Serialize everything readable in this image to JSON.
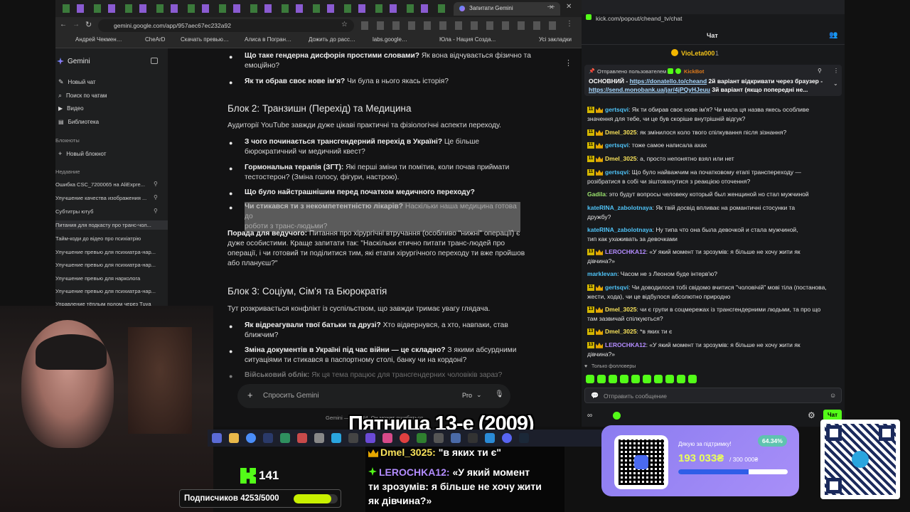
{
  "browser": {
    "address": "gemini.google.com/app/957aec67ec232a92",
    "tab_title": "Запитати Gemini",
    "bookmarks": [
      "Андрей Чекменёк...",
      "CheArD",
      "Скачать превью об...",
      "Алиса в Погранични...",
      "Дожить до рассвет...",
      "labs.google/fx/ru/fx",
      "Юла - Нация Созда...",
      "Усі закладки"
    ]
  },
  "gemini": {
    "brand": "Gemini",
    "nav": [
      "Новый чат",
      "Поиск по чатам",
      "Видео",
      "Библиотека"
    ],
    "notebooks_header": "Блокноты",
    "new_notebook": "Новый блокнот",
    "recent_header": "Недавние",
    "recent": [
      "Ошибка CSC_7200065 на AliExpre...",
      "Улучшение качества изображения ...",
      "Субтитры ютуб",
      "Питания для подкасту про транс-чол...",
      "Тайм-коди до відео про психіатрію",
      "Улучшение превью для психиатра-нар...",
      "Улучшение превью для психиатра-нар...",
      "Улучшение превью для нарколога",
      "Улучшение превью для психиатра-нар...",
      "Управление тёплым полом через Tuya"
    ],
    "content": {
      "b0_bold": "Що таке гендерна дисфорія простими словами?",
      "b0_rest": " Як вона відчувається фізично та",
      "b0_line2": "емоційно?",
      "b1_bold": "Як ти обрав своє нове ім'я?",
      "b1_rest": " Чи була в нього якась історія?",
      "h_block2": "Блок 2: Транзишн (Перехід) та Медицина",
      "p_block2": "Аудиторії YouTube завжди дуже цікаві практичні та фізіологічні аспекти переходу.",
      "b2_bold": "З чого починається трансгендерний перехід в Україні?",
      "b2_rest": " Це більше",
      "b2_line2": "бюрократичний чи медичний квест?",
      "b3_bold": "Гормональна терапія (ЗГТ):",
      "b3_rest": " Які перші зміни ти помітив, коли почав приймати",
      "b3_line2": "тестостерон? (Зміна голосу, фігури, настрою).",
      "b4_bold": "Що було найстрашнішим перед початком медичного переходу?",
      "b5_bold": "Чи стикався ти з некомпетентністю лікарів?",
      "b5_rest": " Наскільки наша медицина готова до",
      "b5_line2": "роботи з транс-людьми?",
      "tip_bold": "Порада для ведучого:",
      "tip_rest": " Питання про хірургічні втручання (особливо \"нижні\" операції) є",
      "tip_l2": "дуже особистими. Краще запитати так: \"Наскільки етично питати транс-людей про",
      "tip_l3": "операції, і чи готовий ти поділитися тим, які етапи хірургічного переходу ти вже пройшов",
      "tip_l4": "або плануєш?\"",
      "h_block3": "Блок 3: Соціум, Сім'я та Бюрократія",
      "p_block3": "Тут розкривається конфлікт із суспільством, що завжди тримає увагу глядача.",
      "b6_bold": "Як відреагували твої батьки та друзі?",
      "b6_rest": " Хто відвернувся, а хто, навпаки, став",
      "b6_line2": "ближчим?",
      "b7_bold": "Зміна документів в Україні під час війни — це складно?",
      "b7_rest": " З якими абсурдними",
      "b7_line2": "ситуаціями ти стикався в паспортному столі, банку чи на кордоні?",
      "b8_bold": "Військовий облік:",
      "b8_rest": " Як ця тема працює для трансгендерних чоловіків зараз?"
    },
    "input_placeholder": "Спросить Gemini",
    "mode": "Pro",
    "footer": "Gemini — это ИИ. Он может ошибаться"
  },
  "chat": {
    "url": "kick.com/popout/cheand_tv/chat",
    "title": "Чат",
    "top_gifter": "VioLeta000",
    "top_gifter_count": "1",
    "pinned_by": "Отправлено пользователем",
    "pinned_user": "KickBot",
    "pinned_text1": "ОСНОВНИЙ - ",
    "pinned_link1": "https://donatello.to/cheand",
    "pinned_text2": " 2й варіант відкривати через браузер -",
    "pinned_link2": "https://send.monobank.ua/jar/4jPQyHJeuu",
    "pinned_text3": " 3й варіант (якщо попередні не...",
    "messages": [
      {
        "b": "11",
        "u": "gertsqvi",
        "c": "#4fc3f7",
        "t": "Як ти обирав своє нове ім'я? Чи мала ця назва якесь особливе",
        "t2": "значення для тебе, чи це був скоріше внутрішній відгук?"
      },
      {
        "b": "11",
        "u": "Dmel_3025",
        "c": "#f7e15a",
        "t": "як змінилося коло твого спілкування після зізнання?"
      },
      {
        "b": "11",
        "u": "gertsqvi",
        "c": "#4fc3f7",
        "t": "тоже самое написала ахах"
      },
      {
        "b": "11",
        "u": "Dmel_3025",
        "c": "#f7e15a",
        "t": "а, просто непонятно взял или нет"
      },
      {
        "b": "11",
        "u": "gertsqvi",
        "c": "#4fc3f7",
        "t": "Що було найважчим на початковому етапі трансперexоду —",
        "t2": "розібратися в собі чи зіштовхнутися з реакцією оточення?"
      },
      {
        "b": "",
        "u": "Gadila",
        "c": "#9be36d",
        "t": "это будут вопросы человеку который был женщиной но стал мужчиной"
      },
      {
        "b": "",
        "u": "kateRINA_zabolotnaya",
        "c": "#4fc3f7",
        "t": "Як твій досвід впливає на романтичні стосунки та",
        "t2": "дружбу?"
      },
      {
        "b": "",
        "u": "kateRINA_zabolotnaya",
        "c": "#4fc3f7",
        "t": "Ну типа что она была девочкой и стала мужчиной,",
        "t2": "тип как ухаживать за девочками"
      },
      {
        "b": "13",
        "u": "LEROCHKA12",
        "c": "#b38cff",
        "t": "«У який момент ти зрозумів: я більше не хочу жити як",
        "t2": "дівчина?»"
      },
      {
        "b": "",
        "u": "marklevan",
        "c": "#4fc3f7",
        "t": "Часом не з Леоном буде інтерв'ю?"
      },
      {
        "b": "11",
        "u": "gertsqvi",
        "c": "#4fc3f7",
        "t": "Чи доводилося тобі свідомо вчитися \"чоловічій\" мові тіла (постанова,",
        "t2": "жести, хода), чи це відбулося абсолютно природно"
      },
      {
        "b": "13",
        "u": "Dmel_3025",
        "c": "#f7e15a",
        "t": "чи є групи в соцмережах із трансгендерними людьми, та про що",
        "t2": "там зазвичай спілкуються?"
      },
      {
        "b": "13",
        "u": "Dmel_3025",
        "c": "#f7e15a",
        "t": "*в яких ти є"
      },
      {
        "b": "13",
        "u": "LEROCHKA12",
        "c": "#b38cff",
        "t": "«У який момент ти зрозумів: я більше не хочу жити як",
        "t2": "дівчина?»"
      }
    ],
    "followers_only": "Только фолловеры",
    "send_placeholder": "Отправить сообщение",
    "send_button": "Чат"
  },
  "overlay": {
    "movie_title": "Пятница 13-е (2009)",
    "kick_count": "141",
    "subs": "Подписчиков 4253/5000",
    "subs_fraction": 0.85,
    "ticker1_user": "Dmel_3025:",
    "ticker1_text": " \"в яких ти є\"",
    "ticker2_user": "LEROCHKA12:",
    "ticker2_text": " «У який момент",
    "ticker2_l2": "ти зрозумів: я більше не хочу жити",
    "ticker2_l3": "як дівчина?»",
    "donate_thanks": "Дякую за підтримку!",
    "donate_percent": "64.34%",
    "donate_amount": "193 033₴",
    "donate_goal": "/ 300 000₴",
    "donate_fraction": 0.6434
  }
}
